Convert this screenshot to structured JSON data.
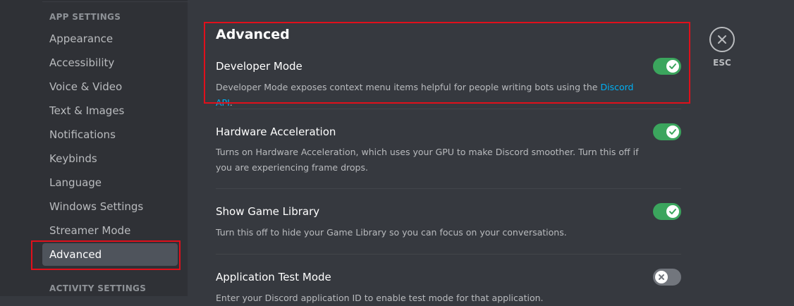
{
  "sidebar": {
    "app_settings_header": "APP SETTINGS",
    "items": [
      {
        "label": "Appearance"
      },
      {
        "label": "Accessibility"
      },
      {
        "label": "Voice & Video"
      },
      {
        "label": "Text & Images"
      },
      {
        "label": "Notifications"
      },
      {
        "label": "Keybinds"
      },
      {
        "label": "Language"
      },
      {
        "label": "Windows Settings"
      },
      {
        "label": "Streamer Mode"
      },
      {
        "label": "Advanced"
      }
    ],
    "selected": "Advanced",
    "activity_settings_header": "ACTIVITY SETTINGS"
  },
  "main": {
    "title": "Advanced",
    "settings": [
      {
        "title": "Developer Mode",
        "description": "Developer Mode exposes context menu items helpful for people writing bots using the ",
        "link_text": "Discord API",
        "description_suffix": ".",
        "enabled": true
      },
      {
        "title": "Hardware Acceleration",
        "description": "Turns on Hardware Acceleration, which uses your GPU to make Discord smoother. Turn this off if you are experiencing frame drops.",
        "enabled": true
      },
      {
        "title": "Show Game Library",
        "description": "Turn this off to hide your Game Library so you can focus on your conversations.",
        "enabled": true
      },
      {
        "title": "Application Test Mode",
        "description": "Enter your Discord application ID to enable test mode for that application.",
        "enabled": false
      }
    ]
  },
  "close": {
    "label": "ESC"
  },
  "colors": {
    "accent_green": "#3ba55d",
    "link_blue": "#00b0f4",
    "highlight_red": "#e0101b",
    "toggle_off": "#72767d"
  }
}
